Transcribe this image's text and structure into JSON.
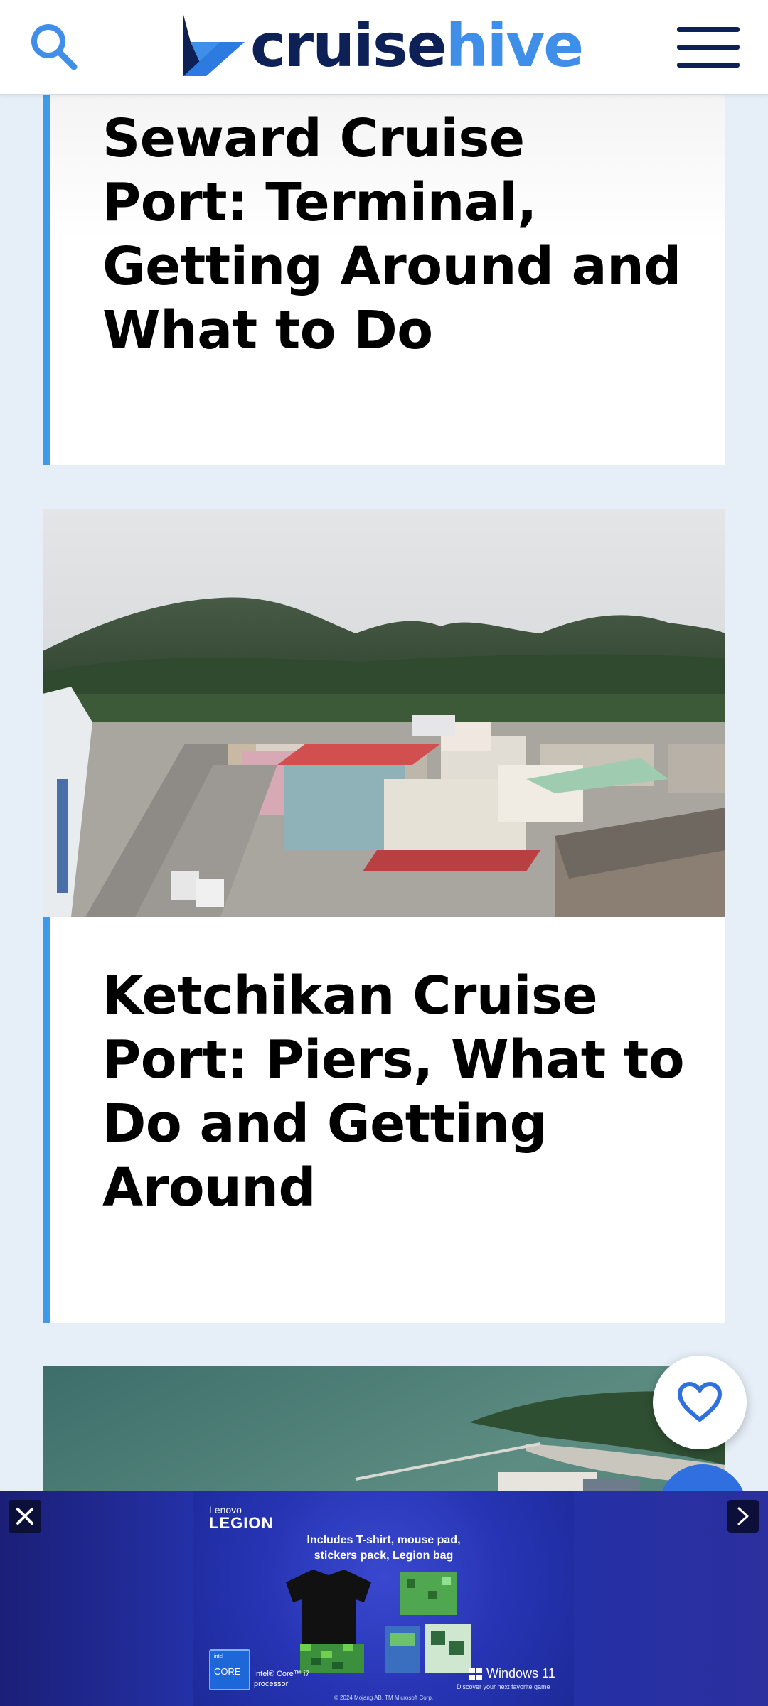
{
  "header": {
    "logo_part1": "cruise",
    "logo_part2": "hive",
    "search_icon": "search-icon",
    "menu_icon": "hamburger-menu-icon"
  },
  "articles": [
    {
      "title": "Seward Cruise Port: Terminal, Getting Around and What to Do"
    },
    {
      "title": "Ketchikan Cruise Port: Piers, What to Do and Getting Around",
      "image": "aerial photo of Ketchikan waterfront town with mountains"
    },
    {
      "title": "",
      "image": "aerial photo of green water bay with pier"
    }
  ],
  "favorite_icon": "heart-icon",
  "ad": {
    "brand_small": "Lenovo",
    "brand": "LEGION",
    "headline_line1": "Includes T-shirt, mouse pad,",
    "headline_line2": "stickers pack, Legion bag",
    "chip_label": "CORE",
    "chip_text": "Intel® Core™ i7 processor",
    "windows": "Windows 11",
    "windows_sub": "Discover your next favorite game",
    "legal": "© 2024 Mojang AB. TM Microsoft Corp.",
    "close_icon": "close-icon",
    "next_icon": "chevron-right-icon"
  },
  "colors": {
    "brand_dark": "#0d2157",
    "brand_blue": "#3f8ee8",
    "accent_bar": "#3f9ae8",
    "page_bg": "#e6eff8"
  }
}
